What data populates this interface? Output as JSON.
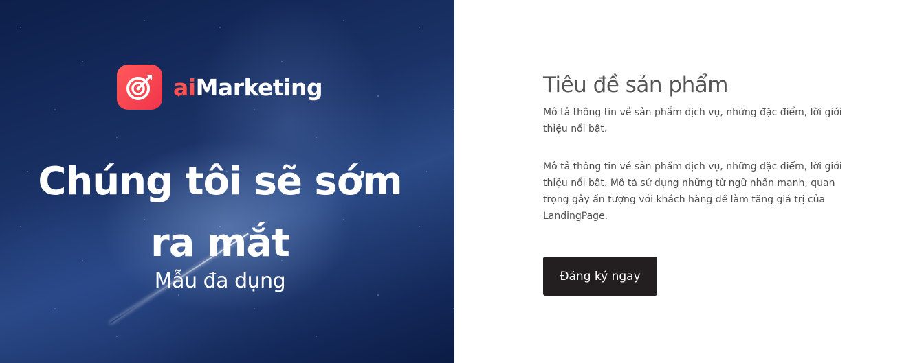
{
  "hero": {
    "logo": {
      "prefix": "ai",
      "name": "Marketing",
      "icon": "target-arrow-icon",
      "badge_color": "#ff4d55"
    },
    "title_line1": "Chúng tôi sẽ sớm",
    "title_line2": "ra mắt",
    "subtitle": "Mẫu đa dụng"
  },
  "product": {
    "title": "Tiêu đề sản phẩm",
    "description_short": "Mô tả thông tin về sản phẩm dịch vụ, những đặc điểm, lời giới thiệu nổi bật.",
    "description_long": "Mô tả thông tin về sản phẩm dịch vụ, những đặc điểm, lời giới thiệu nổi bật. Mô tả sử dụng những từ ngữ nhấn mạnh, quan trọng gây ấn tượng với khách hàng để làm tăng giá trị của LandingPage.",
    "cta_label": "Đăng ký ngay"
  },
  "colors": {
    "accent": "#ff5050",
    "button": "#231f20",
    "text": "#4d4d4d"
  }
}
